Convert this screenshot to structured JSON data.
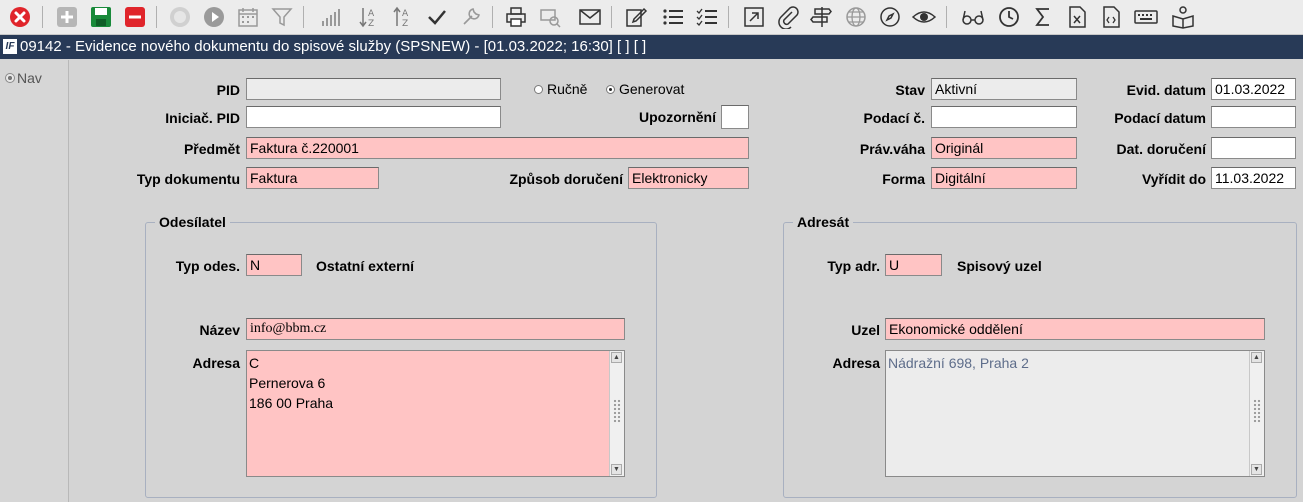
{
  "title": "09142 - Evidence nového dokumentu do spisové služby (SPSNEW) - [01.03.2022; 16:30]  [ ]  [ ]",
  "title_icon_text": "IF",
  "nav": {
    "label": "Nav"
  },
  "colors": {
    "title_bar": "#283a57",
    "required_field": "#ffc4c4",
    "readonly_field": "#ececec"
  },
  "form": {
    "pid": {
      "label": "PID",
      "value": ""
    },
    "mode_manual": {
      "label": "Ručně",
      "selected": false
    },
    "mode_generate": {
      "label": "Generovat",
      "selected": true
    },
    "stav": {
      "label": "Stav",
      "value": "Aktivní"
    },
    "evid_datum": {
      "label": "Evid. datum",
      "value": "01.03.2022"
    },
    "iniciac_pid": {
      "label": "Iniciač. PID",
      "value": ""
    },
    "upozorneni": {
      "label": "Upozornění",
      "value": ""
    },
    "podaci_c": {
      "label": "Podací č.",
      "value": ""
    },
    "podaci_datum": {
      "label": "Podací datum",
      "value": ""
    },
    "predmet": {
      "label": "Předmět",
      "value": "Faktura č.220001"
    },
    "prav_vaha": {
      "label": "Práv.váha",
      "value": "Originál"
    },
    "dat_doruceni": {
      "label": "Dat. doručení",
      "value": ""
    },
    "typ_dokumentu": {
      "label": "Typ dokumentu",
      "value": "Faktura"
    },
    "zpusob_doruceni": {
      "label": "Způsob doručení",
      "value": "Elektronicky"
    },
    "forma": {
      "label": "Forma",
      "value": "Digitální"
    },
    "vyridit_do": {
      "label": "Vyřídit do",
      "value": "11.03.2022"
    }
  },
  "odesilatel": {
    "legend": "Odesílatel",
    "typ_label": "Typ odes.",
    "typ_value": "N",
    "typ_desc": "Ostatní externí",
    "nazev_label": "Název",
    "nazev_value": "info@bbm.cz",
    "adresa_label": "Adresa",
    "adresa_lines": [
      "C",
      "Pernerova 6",
      "186 00 Praha"
    ]
  },
  "adresat": {
    "legend": "Adresát",
    "typ_label": "Typ adr.",
    "typ_value": "U",
    "typ_desc": "Spisový uzel",
    "uzel_label": "Uzel",
    "uzel_value": "Ekonomické oddělení",
    "adresa_label": "Adresa",
    "adresa_lines": [
      "Nádražní 698, Praha 2"
    ]
  },
  "toolbar": [
    "close-icon",
    "add-icon",
    "save-icon",
    "delete-icon",
    "help-icon",
    "play-icon",
    "calendar-icon",
    "filter-icon",
    "bar-chart-icon",
    "sort-az-icon",
    "sort-za-icon",
    "check-icon",
    "wrench-icon",
    "print-icon",
    "print-preview-icon",
    "mail-icon",
    "edit-icon",
    "list-icon",
    "checklist-icon",
    "external-link-icon",
    "attach-icon",
    "signpost-icon",
    "globe-icon",
    "compass-icon",
    "eye-icon",
    "glasses-icon",
    "clock-icon",
    "sum-icon",
    "excel-icon",
    "code-file-icon",
    "keyboard-icon",
    "reader-icon"
  ]
}
